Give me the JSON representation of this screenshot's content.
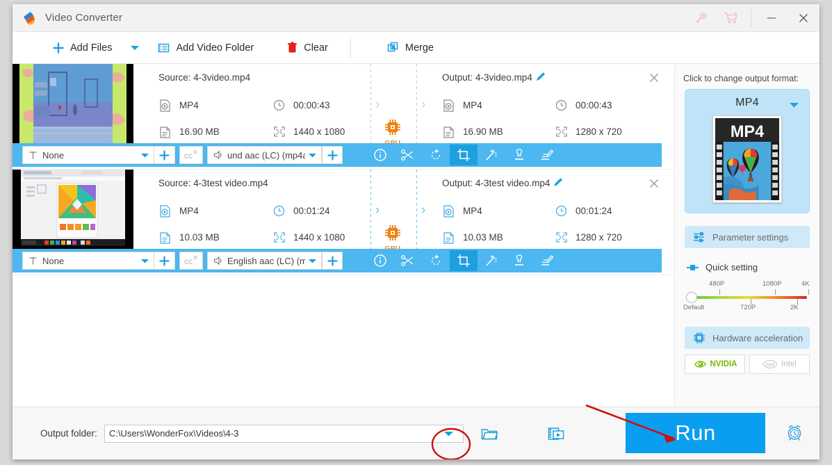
{
  "window": {
    "title": "Video Converter",
    "controls": {
      "minimize": "minimize-icon",
      "close": "close-icon",
      "key": "key-icon",
      "cart": "cart-icon"
    }
  },
  "toolbar": {
    "add_files": "Add Files",
    "add_files_caret": "caret-down-icon",
    "add_video_folder": "Add Video Folder",
    "clear": "Clear",
    "merge": "Merge"
  },
  "items": [
    {
      "source_label": "Source: 4-3video.mp4",
      "source_format": "MP4",
      "source_duration": "00:00:43",
      "source_size": "16.90 MB",
      "source_resolution": "1440 x 1080",
      "gpu_label": "GPU",
      "output_label": "Output: 4-3video.mp4",
      "output_format": "MP4",
      "output_duration": "00:00:43",
      "output_size": "16.90 MB",
      "output_resolution": "1280 x 720",
      "subtitle_value": "None",
      "audio_value": "und aac (LC) (mp4a"
    },
    {
      "source_label": "Source: 4-3test video.mp4",
      "source_format": "MP4",
      "source_duration": "00:01:24",
      "source_size": "10.03 MB",
      "source_resolution": "1440 x 1080",
      "gpu_label": "GPU",
      "output_label": "Output: 4-3test video.mp4",
      "output_format": "MP4",
      "output_duration": "00:01:24",
      "output_size": "10.03 MB",
      "output_resolution": "1280 x 720",
      "subtitle_value": "None",
      "audio_value": "English aac (LC) (mp"
    }
  ],
  "item_tools": [
    "info-icon",
    "cut-icon",
    "rotate-icon",
    "crop-icon",
    "effect-icon",
    "watermark-icon",
    "subtitle-icon"
  ],
  "right_panel": {
    "change_format_label": "Click to change output format:",
    "format_name": "MP4",
    "format_thumb_text": "MP4",
    "parameter_settings": "Parameter settings",
    "quick_setting": "Quick setting",
    "slider": {
      "labels_above": [
        "480P",
        "1080P",
        "4K"
      ],
      "labels_below": [
        "Default",
        "720P",
        "2K"
      ],
      "value": "Default"
    },
    "hardware_acceleration": "Hardware acceleration",
    "vendors": [
      {
        "name": "NVIDIA",
        "enabled": true
      },
      {
        "name": "Intel",
        "enabled": false
      }
    ]
  },
  "bottom": {
    "output_folder_label": "Output folder:",
    "output_folder_path": "C:\\Users\\WonderFox\\Videos\\4-3",
    "dropdown_icon": "caret-down-icon",
    "open_folder_icon": "folder-icon",
    "media_icon": "video-folder-icon",
    "run_label": "Run",
    "alarm_icon": "alarm-clock-icon"
  },
  "colors": {
    "accent_blue": "#0a9ef0",
    "bar_blue": "#4cb7f0",
    "gpu_orange": "#f08010",
    "annotation_red": "#cc1111",
    "nvidia_green": "#76b900"
  }
}
